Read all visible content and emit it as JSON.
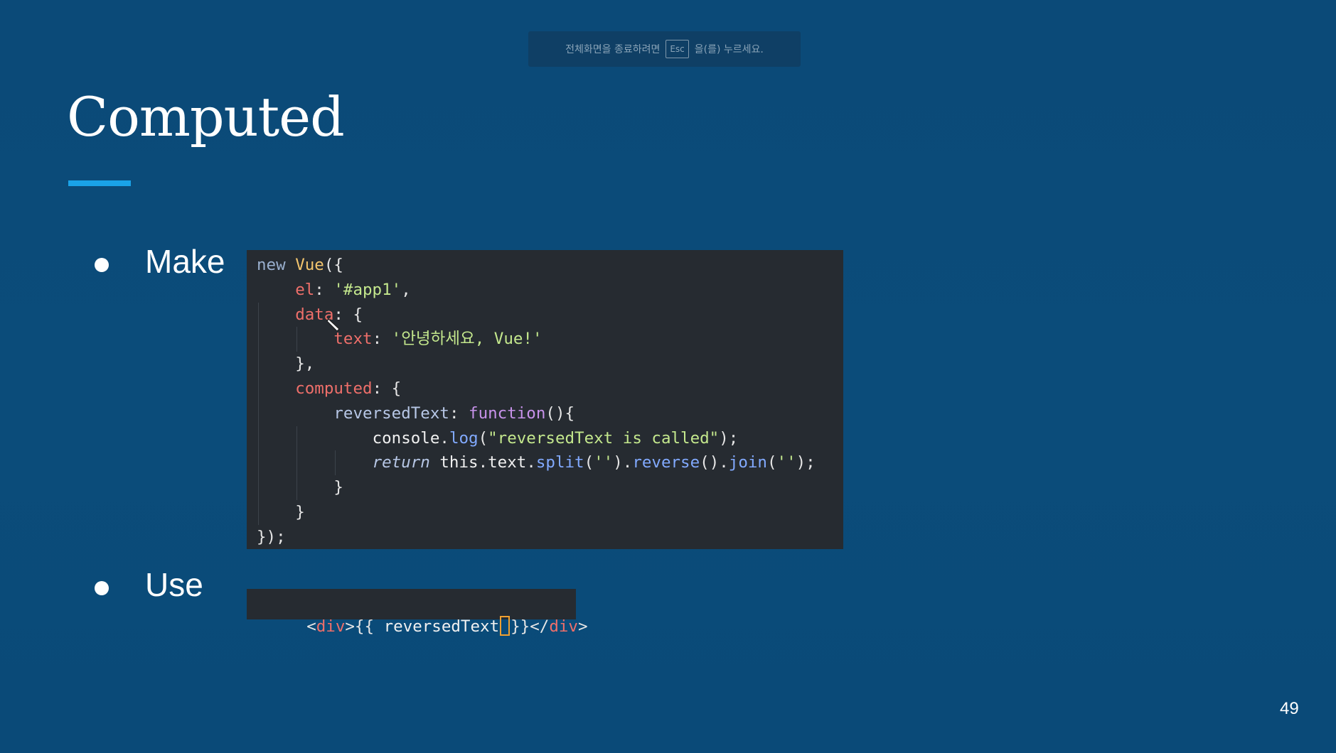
{
  "fullscreen_notice": {
    "prefix": "전체화면을 종료하려면",
    "key": "Esc",
    "suffix": "을(를) 누르세요."
  },
  "slide": {
    "title": "Computed",
    "bullets": [
      {
        "label": "Make"
      },
      {
        "label": "Use"
      }
    ],
    "page_number": "49"
  },
  "code": {
    "make_lines": [
      "new Vue({",
      "    el: '#app1',",
      "    data: {",
      "        text: '안녕하세요, Vue!'",
      "    },",
      "    computed: {",
      "        reversedText: function(){",
      "            console.log(\"reversedText is called\");",
      "            return this.text.split('').reverse().join('');",
      "        }",
      "    }",
      "});"
    ],
    "use_line": {
      "before_cursor": "<div>{{ reversedText",
      "after_cursor": "}}</div>"
    }
  },
  "colors": {
    "background": "#0b4a78",
    "accent_underline": "#1aa3e8",
    "code_background": "#262b31"
  }
}
